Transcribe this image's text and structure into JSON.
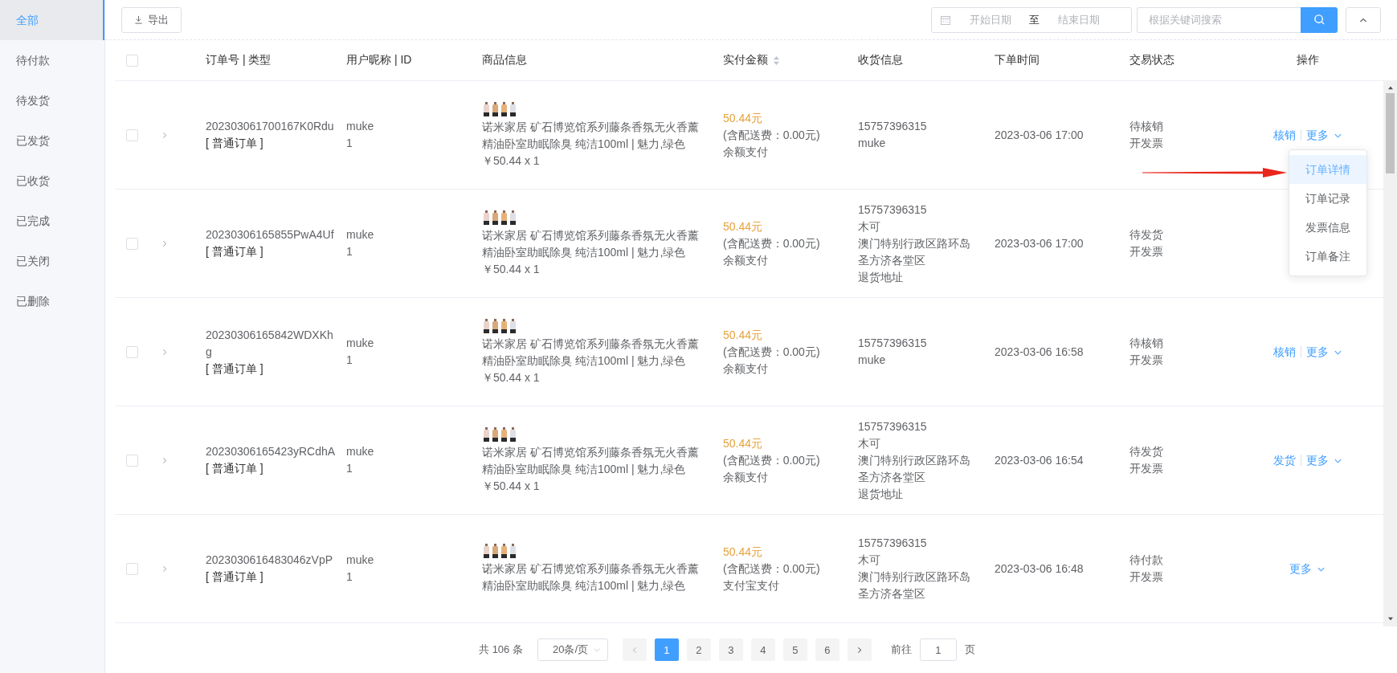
{
  "sidebar": {
    "items": [
      {
        "label": "全部",
        "selected": true
      },
      {
        "label": "待付款",
        "selected": false
      },
      {
        "label": "待发货",
        "selected": false
      },
      {
        "label": "已发货",
        "selected": false
      },
      {
        "label": "已收货",
        "selected": false
      },
      {
        "label": "已完成",
        "selected": false
      },
      {
        "label": "已关闭",
        "selected": false
      },
      {
        "label": "已删除",
        "selected": false
      }
    ]
  },
  "toolbar": {
    "export_button": "导出",
    "date_range": {
      "start_placeholder": "开始日期",
      "separator": "至",
      "end_placeholder": "结束日期"
    },
    "search": {
      "placeholder": "根据关键词搜索"
    }
  },
  "table": {
    "select_all_checked": false,
    "columns": [
      {
        "label": "订单号 | 类型",
        "kind": "plain"
      },
      {
        "label": "用户昵称 | ID",
        "kind": "plain"
      },
      {
        "label": "商品信息",
        "kind": "plain"
      },
      {
        "label": "实付金额",
        "kind": "sortable"
      },
      {
        "label": "收货信息",
        "kind": "plain"
      },
      {
        "label": "下单时间",
        "kind": "plain"
      },
      {
        "label": "交易状态",
        "kind": "plain"
      },
      {
        "label": "操作",
        "kind": "plain"
      }
    ],
    "rows": [
      {
        "checked": false,
        "order_no": "202303061700167K0Rdu",
        "order_type": "[ 普通订单 ]",
        "nickname": "muke",
        "user_id": "1",
        "product_name": "诺米家居 矿石博览馆系列藤条香氛无火香薰精油卧室助眠除臭 纯洁100ml | 魅力,绿色",
        "product_price": "￥50.44 x 1",
        "amount": "50.44元",
        "delivery_fee": "(含配送费：0.00元)",
        "payment": "余额支付",
        "shipping": [
          "15757396315",
          "muke"
        ],
        "time": "2023-03-06 17:00",
        "status": [
          "待核销",
          "开发票"
        ],
        "actions": [
          {
            "label": "核销",
            "kind": "link"
          },
          {
            "label": "更多",
            "kind": "more"
          }
        ],
        "menu_open": true
      },
      {
        "checked": false,
        "order_no": "20230306165855PwA4Uf",
        "order_type": "[ 普通订单 ]",
        "nickname": "muke",
        "user_id": "1",
        "product_name": "诺米家居 矿石博览馆系列藤条香氛无火香薰精油卧室助眠除臭 纯洁100ml | 魅力,绿色",
        "product_price": "￥50.44 x 1",
        "amount": "50.44元",
        "delivery_fee": "(含配送费：0.00元)",
        "payment": "余额支付",
        "shipping": [
          "15757396315",
          "木可",
          "澳门特别行政区路环岛",
          "圣方济各堂区",
          "退货地址"
        ],
        "time": "2023-03-06 17:00",
        "status": [
          "待发货",
          "开发票"
        ],
        "actions": [],
        "menu_open": false
      },
      {
        "checked": false,
        "order_no": "20230306165842WDXKhg",
        "order_type": "[ 普通订单 ]",
        "nickname": "muke",
        "user_id": "1",
        "product_name": "诺米家居 矿石博览馆系列藤条香氛无火香薰精油卧室助眠除臭 纯洁100ml | 魅力,绿色",
        "product_price": "￥50.44 x 1",
        "amount": "50.44元",
        "delivery_fee": "(含配送费：0.00元)",
        "payment": "余额支付",
        "shipping": [
          "15757396315",
          "muke"
        ],
        "time": "2023-03-06 16:58",
        "status": [
          "待核销",
          "开发票"
        ],
        "actions": [
          {
            "label": "核销",
            "kind": "link"
          },
          {
            "label": "更多",
            "kind": "more"
          }
        ],
        "menu_open": false
      },
      {
        "checked": false,
        "order_no": "20230306165423yRCdhA",
        "order_type": "[ 普通订单 ]",
        "nickname": "muke",
        "user_id": "1",
        "product_name": "诺米家居 矿石博览馆系列藤条香氛无火香薰精油卧室助眠除臭 纯洁100ml | 魅力,绿色",
        "product_price": "￥50.44 x 1",
        "amount": "50.44元",
        "delivery_fee": "(含配送费：0.00元)",
        "payment": "余额支付",
        "shipping": [
          "15757396315",
          "木可",
          "澳门特别行政区路环岛",
          "圣方济各堂区",
          "退货地址"
        ],
        "time": "2023-03-06 16:54",
        "status": [
          "待发货",
          "开发票"
        ],
        "actions": [
          {
            "label": "发货",
            "kind": "link"
          },
          {
            "label": "更多",
            "kind": "more"
          }
        ],
        "menu_open": false
      },
      {
        "checked": false,
        "order_no": "2023030616483046zVpP",
        "order_type": "[ 普通订单 ]",
        "nickname": "muke",
        "user_id": "1",
        "product_name": "诺米家居 矿石博览馆系列藤条香氛无火香薰精油卧室助眠除臭 纯洁100ml | 魅力,绿色",
        "product_price": "",
        "amount": "50.44元",
        "delivery_fee": "(含配送费：0.00元)",
        "payment": "支付宝支付",
        "shipping": [
          "15757396315",
          "木可",
          "澳门特别行政区路环岛",
          "圣方济各堂区"
        ],
        "time": "2023-03-06 16:48",
        "status": [
          "待付款",
          "开发票"
        ],
        "actions": [
          {
            "label": "更多",
            "kind": "more"
          }
        ],
        "menu_open": false
      }
    ]
  },
  "more_menu": {
    "items": [
      {
        "label": "订单详情",
        "selected": true
      },
      {
        "label": "订单记录",
        "selected": false
      },
      {
        "label": "发票信息",
        "selected": false
      },
      {
        "label": "订单备注",
        "selected": false
      }
    ]
  },
  "pagination": {
    "total": "共 106 条",
    "page_size": "20条/页",
    "pages": [
      {
        "label": "1",
        "selected": true
      },
      {
        "label": "2",
        "selected": false
      },
      {
        "label": "3",
        "selected": false
      },
      {
        "label": "4",
        "selected": false
      },
      {
        "label": "5",
        "selected": false
      },
      {
        "label": "6",
        "selected": false
      }
    ],
    "goto_label": "前往",
    "goto_value": "1",
    "goto_suffix": "页"
  }
}
